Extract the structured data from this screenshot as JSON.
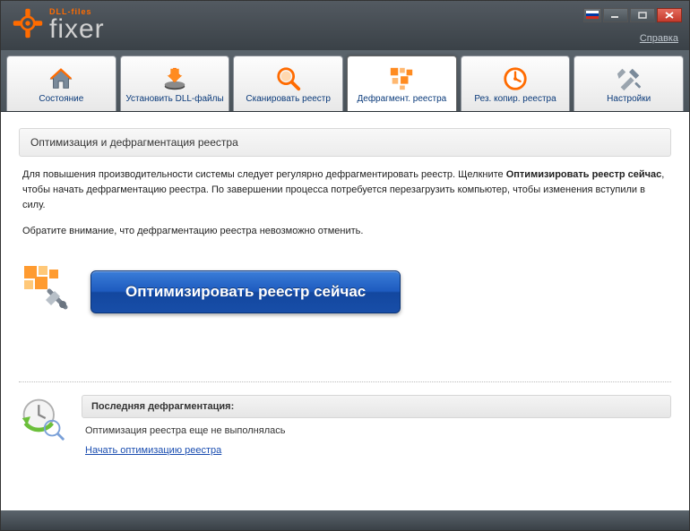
{
  "app": {
    "brand_small": "DLL-files",
    "brand_main": "fixer",
    "help_label": "Справка"
  },
  "tabs": [
    {
      "label": "Состояние"
    },
    {
      "label": "Установить DLL-файлы"
    },
    {
      "label": "Сканировать реестр"
    },
    {
      "label": "Дефрагмент. реестра"
    },
    {
      "label": "Рез. копир. реестра"
    },
    {
      "label": "Настройки"
    }
  ],
  "section": {
    "heading": "Оптимизация и дефрагментация реестра",
    "para1_a": "Для повышения производительности системы следует регулярно дефрагментировать реестр. Щелкните ",
    "para1_b": "Оптимизировать реестр сейчас",
    "para1_c": ", чтобы начать дефрагментацию реестра. По завершении процесса потребуется перезагрузить компьютер, чтобы изменения вступили в силу.",
    "para2": "Обратите внимание, что дефрагментацию реестра невозможно отменить."
  },
  "action": {
    "button_label": "Оптимизировать реестр сейчас"
  },
  "last": {
    "title": "Последняя дефрагментация:",
    "status": "Оптимизация реестра еще не выполнялась",
    "link": "Начать оптимизацию реестра"
  }
}
